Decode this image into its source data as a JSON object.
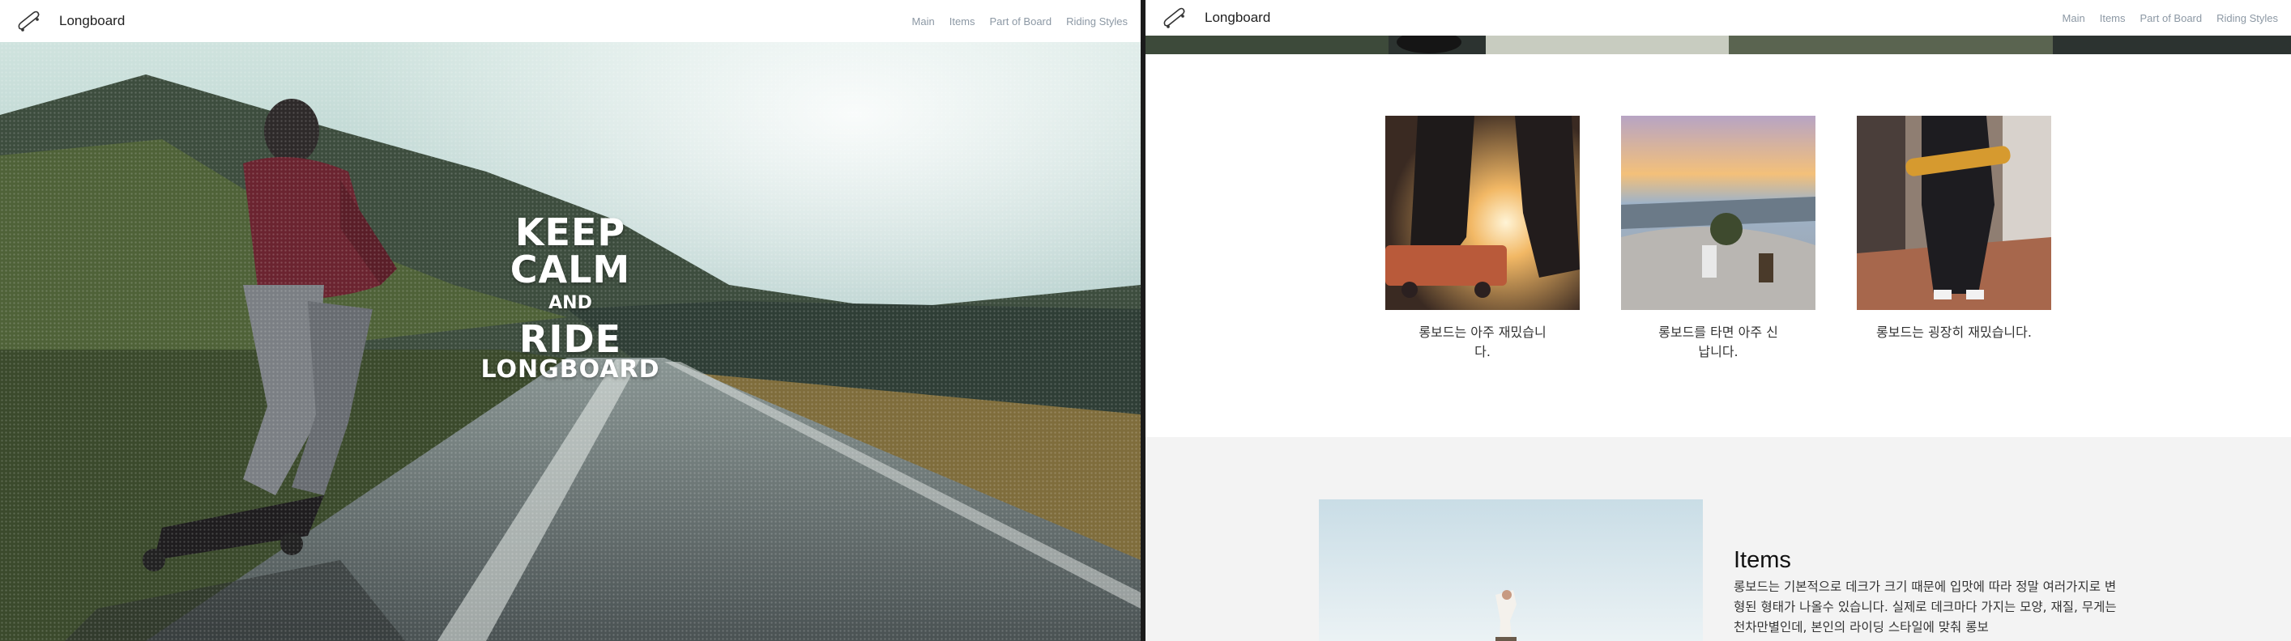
{
  "site": {
    "brand": "Longboard",
    "nav": [
      "Main",
      "Items",
      "Part of Board",
      "Riding Styles"
    ]
  },
  "hero": {
    "lines": [
      "KEEP",
      "CALM",
      "AND",
      "RIDE",
      "LONGBOARD"
    ]
  },
  "gallery": [
    {
      "caption": "롱보드는 아주 재밌습니다."
    },
    {
      "caption": "롱보드를 타면 아주 신납니다."
    },
    {
      "caption": "롱보드는 굉장히 재밌습니다."
    }
  ],
  "items": {
    "title": "Items",
    "description": "롱보드는 기본적으로 데크가 크기 때문에 입맛에 따라 정말 여러가지로 변형된 형태가 나올수 있습니다. 실제로 데크마다 가지는 모양, 재질, 무게는 천차만별인데, 본인의 라이딩 스타일에 맞춰 롱보"
  }
}
